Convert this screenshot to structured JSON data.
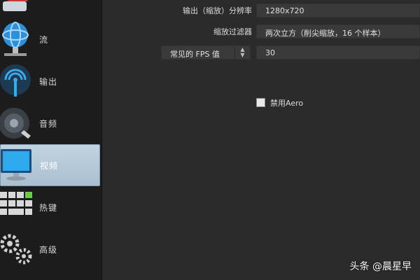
{
  "sidebar": {
    "items": [
      {
        "label": "",
        "icon": "broadcast-settings-icon"
      },
      {
        "label": "流",
        "icon": "globe-stream-icon"
      },
      {
        "label": "输出",
        "icon": "antenna-output-icon"
      },
      {
        "label": "音频",
        "icon": "speaker-audio-icon"
      },
      {
        "label": "视频",
        "icon": "monitor-video-icon",
        "active": true
      },
      {
        "label": "热键",
        "icon": "keyboard-hotkey-icon"
      },
      {
        "label": "高级",
        "icon": "gears-advanced-icon"
      }
    ]
  },
  "video": {
    "output_resolution_label": "输出（缩放）分辨率",
    "output_resolution_value": "1280x720",
    "downscale_filter_label": "缩放过滤器",
    "downscale_filter_value": "两次立方（削尖缩放，16 个样本）",
    "fps_type_value": "常见的 FPS 值",
    "fps_value": "30",
    "disable_aero_label": "禁用Aero"
  },
  "watermark": "头条 @晨星早",
  "colors": {
    "background": "#2b2b2b",
    "sidebar": "#1c1c1c",
    "active_item": "#b5c8d8",
    "field": "#3a3a3a"
  }
}
